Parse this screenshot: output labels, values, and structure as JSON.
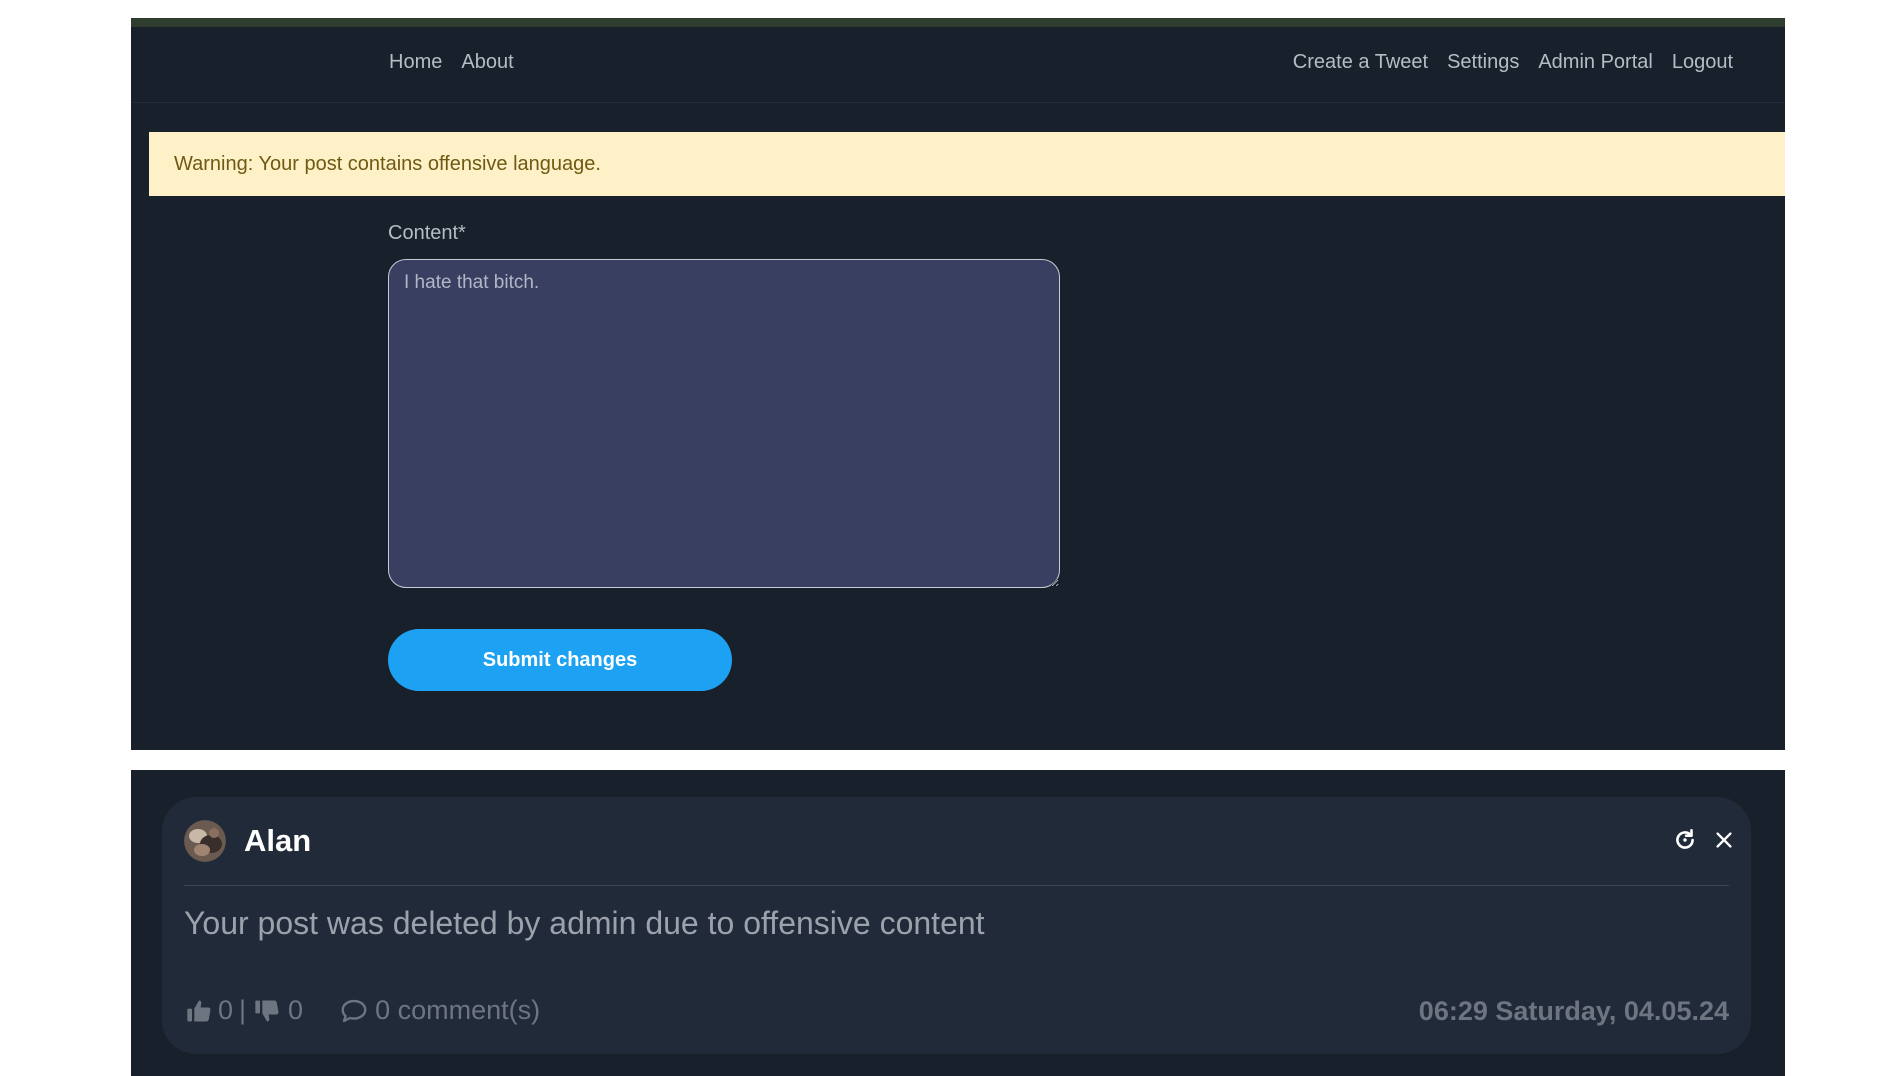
{
  "navbar": {
    "left_links": [
      {
        "label": "Home"
      },
      {
        "label": "About"
      }
    ],
    "right_links": [
      {
        "label": "Create a Tweet"
      },
      {
        "label": "Settings"
      },
      {
        "label": "Admin Portal"
      },
      {
        "label": "Logout"
      }
    ]
  },
  "alert": {
    "text": "Warning: Your post contains offensive language."
  },
  "form": {
    "content_label": "Content*",
    "content_value": "I hate that bitch.",
    "submit_label": "Submit changes"
  },
  "post": {
    "author": "Alan",
    "body": "Your post was deleted by admin due to offensive content",
    "likes": "0",
    "separator": "|",
    "dislikes": "0",
    "comments": "0 comment(s)",
    "timestamp": "06:29 Saturday, 04.05.24",
    "icons": [
      "thumbs-up-icon",
      "thumbs-down-icon",
      "comment-icon",
      "refresh-icon",
      "close-icon"
    ]
  },
  "colors": {
    "page_background": "#18202b",
    "accent_bar": "#2f3d2f",
    "alert_background": "#fff1c7",
    "textarea_background": "#383f60",
    "primary_button": "#1da1f2",
    "card_background": "#212a38"
  }
}
